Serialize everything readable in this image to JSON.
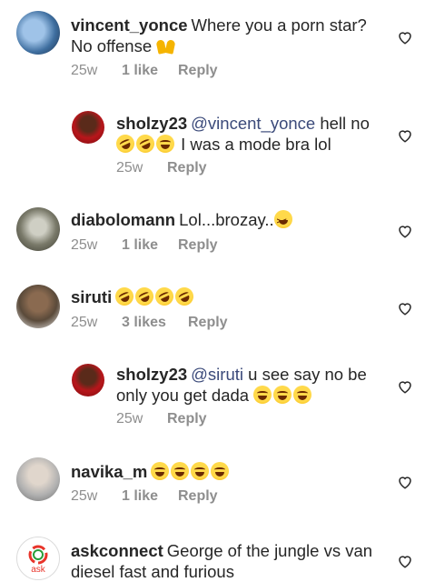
{
  "comments": [
    {
      "username": "vincent_yonce",
      "text": "Where you a porn star? No offense",
      "time": "25w",
      "likes": "1 like",
      "reply": "Reply",
      "avatar_color": "#3f6fa0"
    },
    {
      "username": "sholzy23",
      "mention": "@vincent_yonce",
      "text": "hell no",
      "text2": "I was a mode bra lol",
      "time": "25w",
      "reply": "Reply",
      "avatar_color": "#b8161b"
    },
    {
      "username": "diabolomann",
      "text": "Lol...brozay..",
      "time": "25w",
      "likes": "1 like",
      "reply": "Reply",
      "avatar_color": "#7a7a6a"
    },
    {
      "username": "siruti",
      "text": "",
      "time": "25w",
      "likes": "3 likes",
      "reply": "Reply",
      "avatar_color": "#5a4a3a"
    },
    {
      "username": "sholzy23",
      "mention": "@siruti",
      "text": "u see say no be only you get dada",
      "time": "25w",
      "reply": "Reply",
      "avatar_color": "#b8161b"
    },
    {
      "username": "navika_m",
      "text": "",
      "time": "25w",
      "likes": "1 like",
      "reply": "Reply",
      "avatar_color": "#b0b0b0"
    },
    {
      "username": "askconnect",
      "text": "George of the jungle vs van diesel fast and furious",
      "time": "",
      "reply": "",
      "avatar_color": "#ffffff",
      "logo_text": "ask"
    }
  ],
  "icons": {
    "heart": "heart-outline-icon",
    "emoji_laugh": "face-with-tears-of-joy-icon",
    "emoji_rofl": "rolling-on-the-floor-laughing-icon",
    "emoji_hands": "raising-hands-icon",
    "emoji_squint": "grinning-squinting-face-icon"
  },
  "colors": {
    "text": "#262626",
    "meta": "#8e8e8e",
    "mention": "#3b4a7a"
  }
}
